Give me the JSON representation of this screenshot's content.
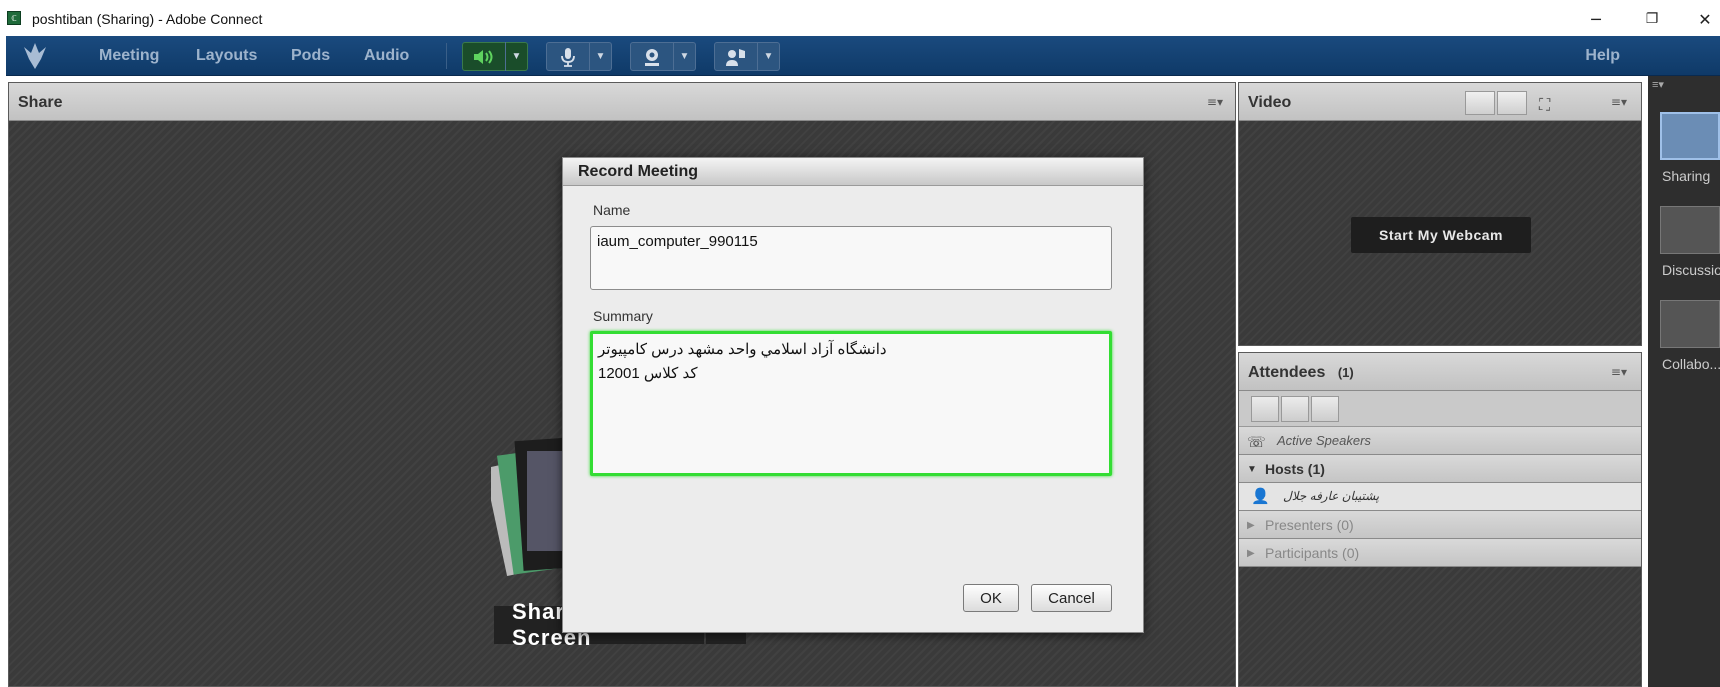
{
  "window": {
    "title": "poshtiban (Sharing) - Adobe Connect",
    "controls": [
      "minimize-icon",
      "restore-icon",
      "close-icon"
    ]
  },
  "menubar": {
    "items": [
      "Meeting",
      "Layouts",
      "Pods",
      "Audio"
    ],
    "help": "Help",
    "toolbar": [
      "speaker-icon",
      "microphone-icon",
      "webcam-icon",
      "raise-hand-icon"
    ]
  },
  "share_pod": {
    "title": "Share",
    "share_button": "Share My Screen"
  },
  "video_pod": {
    "title": "Video",
    "webcam_button": "Start My Webcam"
  },
  "attendees_pod": {
    "title": "Attendees",
    "count": "(1)",
    "active_speakers": "Active Speakers",
    "hosts": "Hosts (1)",
    "host_name": "پشتیبان عارفه جلال",
    "presenters": "Presenters (0)",
    "participants": "Participants (0)"
  },
  "layouts_bar": {
    "items": [
      "Sharing",
      "Discussio",
      "Collabo..."
    ]
  },
  "dialog": {
    "title": "Record Meeting",
    "name_label": "Name",
    "name_value": "iaum_computer_990115",
    "summary_label": "Summary",
    "summary_line1": "دانشگاه آزاد اسلامي واحد مشهد درس كامپيوتر",
    "summary_line2": "كد كلاس 12001",
    "ok": "OK",
    "cancel": "Cancel"
  },
  "colors": {
    "menubar": "#0f3a68",
    "focus_border": "#33dd33",
    "audio_active": "#1a6a2a"
  }
}
